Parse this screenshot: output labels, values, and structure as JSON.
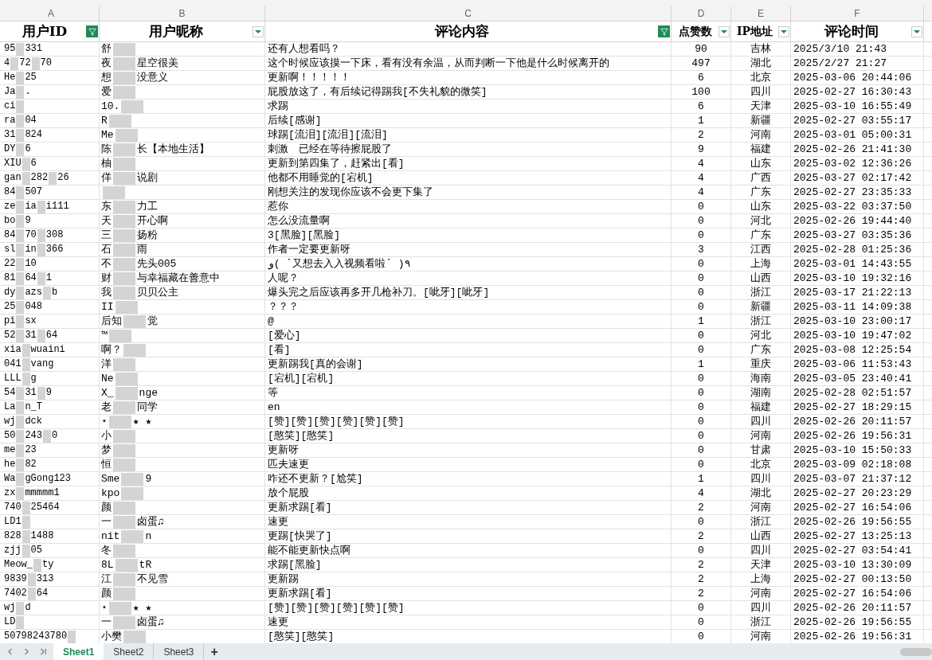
{
  "column_letters": [
    "A",
    "B",
    "C",
    "D",
    "E",
    "F"
  ],
  "header_row": [
    {
      "label": "用户ID",
      "filtered": true
    },
    {
      "label": "用户昵称",
      "filtered": false
    },
    {
      "label": "评论内容",
      "filtered": true
    },
    {
      "label": "点赞数",
      "filtered": false
    },
    {
      "label": "IP地址",
      "filtered": false
    },
    {
      "label": "评论时间",
      "filtered": false
    }
  ],
  "rows": [
    {
      "user_id": [
        "95",
        "331"
      ],
      "nickname": [
        "舒"
      ],
      "comment": "还有人想看吗？",
      "likes": "90",
      "ip": "吉林",
      "time": "2025/3/10 21:43"
    },
    {
      "user_id": [
        "4",
        "72",
        "70"
      ],
      "nickname": [
        "夜",
        "星空很美"
      ],
      "comment": "这个时候应该摸一下床，看有没有余温，从而判断一下他是什么时候离开的",
      "likes": "497",
      "ip": "湖北",
      "time": "2025/2/27 21:27"
    },
    {
      "user_id": [
        "He",
        "25"
      ],
      "nickname": [
        "想",
        "没意义"
      ],
      "comment": "更新啊！！！！！",
      "likes": "6",
      "ip": "北京",
      "time": "2025-03-06 20:44:06"
    },
    {
      "user_id": [
        "Ja",
        "."
      ],
      "nickname": [
        "爱"
      ],
      "comment": "屁股放这了，有后续记得踢我[不失礼貌的微笑]",
      "likes": "100",
      "ip": "四川",
      "time": "2025-02-27 16:30:43"
    },
    {
      "user_id": [
        "ci"
      ],
      "nickname": [
        "10."
      ],
      "comment": "求踢",
      "likes": "6",
      "ip": "天津",
      "time": "2025-03-10 16:55:49"
    },
    {
      "user_id": [
        "ra",
        "04"
      ],
      "nickname": [
        "R"
      ],
      "comment": "后续[感谢]",
      "likes": "1",
      "ip": "新疆",
      "time": "2025-02-27 03:55:17"
    },
    {
      "user_id": [
        "31",
        "824"
      ],
      "nickname": [
        "Me"
      ],
      "comment": "球踢[流泪][流泪][流泪]",
      "likes": "2",
      "ip": "河南",
      "time": "2025-03-01 05:00:31"
    },
    {
      "user_id": [
        "DY",
        "6"
      ],
      "nickname": [
        "陈",
        "长【本地生活】"
      ],
      "comment": "刺激　已经在等待擦屁股了",
      "likes": "9",
      "ip": "福建",
      "time": "2025-02-26 21:41:30"
    },
    {
      "user_id": [
        "XIU",
        "6"
      ],
      "nickname": [
        "柚"
      ],
      "comment": "更新到第四集了，赶紧出[看]",
      "likes": "4",
      "ip": "山东",
      "time": "2025-03-02 12:36:26"
    },
    {
      "user_id": [
        "gan",
        "282",
        "26"
      ],
      "nickname": [
        "佯",
        "说剧"
      ],
      "comment": "他都不用睡觉的[宕机]",
      "likes": "4",
      "ip": "广西",
      "time": "2025-03-27 02:17:42"
    },
    {
      "user_id": [
        "84",
        "507"
      ],
      "comment": "刚想关注的发现你应该不会更下集了",
      "likes": "4",
      "ip": "广东",
      "time": "2025-02-27 23:35:33"
    },
    {
      "user_id": [
        "ze",
        "ia",
        "i111"
      ],
      "nickname": [
        "东",
        "力工"
      ],
      "comment": "惹你",
      "likes": "0",
      "ip": "山东",
      "time": "2025-03-22 03:37:50"
    },
    {
      "user_id": [
        "bo",
        "9"
      ],
      "nickname": [
        "天",
        "开心啊"
      ],
      "comment": "怎么没流量啊",
      "likes": "0",
      "ip": "河北",
      "time": "2025-02-26 19:44:40"
    },
    {
      "user_id": [
        "84",
        "70",
        "308"
      ],
      "nickname": [
        "三",
        "扬粉"
      ],
      "comment": "3[黑脸][黑脸]",
      "likes": "0",
      "ip": "广东",
      "time": "2025-03-27 03:35:36"
    },
    {
      "user_id": [
        "sl",
        "in",
        "366"
      ],
      "nickname": [
        "石",
        "雨"
      ],
      "comment": "作者一定要更新呀",
      "likes": "3",
      "ip": "江西",
      "time": "2025-02-28 01:25:36"
    },
    {
      "user_id": [
        "22",
        "10"
      ],
      "nickname": [
        "不",
        "先头005"
      ],
      "comment": "و( ˋ又想去入入视频看啦ˊ )٩",
      "likes": "0",
      "ip": "上海",
      "time": "2025-03-01 14:43:55"
    },
    {
      "user_id": [
        "81",
        "64",
        "1"
      ],
      "nickname": [
        "财",
        "与幸福藏在善意中"
      ],
      "comment": "人呢？",
      "likes": "0",
      "ip": "山西",
      "time": "2025-03-10 19:32:16"
    },
    {
      "user_id": [
        "dy",
        "azs",
        "b"
      ],
      "nickname": [
        "我",
        "贝贝公主"
      ],
      "comment": "爆头完之后应该再多开几枪补刀。[呲牙][呲牙]",
      "likes": "0",
      "ip": "浙江",
      "time": "2025-03-17 21:22:13"
    },
    {
      "user_id": [
        "25",
        "048"
      ],
      "nickname": [
        "II"
      ],
      "comment": "？？？",
      "likes": "0",
      "ip": "新疆",
      "time": "2025-03-11 14:09:38"
    },
    {
      "user_id": [
        "pi",
        "sx"
      ],
      "nickname": [
        "后知",
        "觉"
      ],
      "comment": "@",
      "likes": "1",
      "ip": "浙江",
      "time": "2025-03-10 23:00:17"
    },
    {
      "user_id": [
        "52",
        "31",
        "64"
      ],
      "nickname": [
        "™"
      ],
      "comment": "[爱心]",
      "likes": "0",
      "ip": "河北",
      "time": "2025-03-10 19:47:02"
    },
    {
      "user_id": [
        "xia",
        "wuaini"
      ],
      "nickname": [
        "啊？"
      ],
      "comment": "[看]",
      "likes": "0",
      "ip": "广东",
      "time": "2025-03-08 12:25:54"
    },
    {
      "user_id": [
        "041",
        "vang"
      ],
      "nickname": [
        "洋"
      ],
      "comment": "更新踢我[真的会谢]",
      "likes": "1",
      "ip": "重庆",
      "time": "2025-03-06 11:53:43"
    },
    {
      "user_id": [
        "LLL",
        "g"
      ],
      "nickname": [
        "Ne"
      ],
      "comment": "[宕机][宕机]",
      "likes": "0",
      "ip": "海南",
      "time": "2025-03-05 23:40:41"
    },
    {
      "user_id": [
        "54",
        "31",
        "9"
      ],
      "nickname": [
        "X_",
        "nge"
      ],
      "comment": "等",
      "likes": "0",
      "ip": "湖南",
      "time": "2025-02-28 02:51:57"
    },
    {
      "user_id": [
        "La",
        "n_T"
      ],
      "nickname": [
        "老",
        "同学"
      ],
      "comment": "en",
      "likes": "0",
      "ip": "福建",
      "time": "2025-02-27 18:29:15"
    },
    {
      "user_id": [
        "wj",
        "dck"
      ],
      "nickname": [
        "⋆",
        "★ ★"
      ],
      "comment": "[赞][赞][赞][赞][赞][赞]",
      "likes": "0",
      "ip": "四川",
      "time": "2025-02-26 20:11:57"
    },
    {
      "user_id": [
        "50",
        "243",
        "0"
      ],
      "nickname": [
        "小"
      ],
      "comment": "[憨笑][憨笑]",
      "likes": "0",
      "ip": "河南",
      "time": "2025-02-26 19:56:31"
    },
    {
      "user_id": [
        "me",
        "23"
      ],
      "nickname": [
        "梦"
      ],
      "comment": "更新呀",
      "likes": "0",
      "ip": "甘肃",
      "time": "2025-03-10 15:50:33"
    },
    {
      "user_id": [
        "he",
        "82"
      ],
      "nickname": [
        "恒"
      ],
      "comment": "匹夫速更",
      "likes": "0",
      "ip": "北京",
      "time": "2025-03-09 02:18:08"
    },
    {
      "user_id": [
        "Wa",
        "gGong123"
      ],
      "nickname": [
        "Sme",
        "9"
      ],
      "comment": "咋还不更新？[尬笑]",
      "likes": "1",
      "ip": "四川",
      "time": "2025-03-07 21:37:12"
    },
    {
      "user_id": [
        "zx",
        "mmmmm1"
      ],
      "nickname": [
        "kpo"
      ],
      "comment": "放个屁股",
      "likes": "4",
      "ip": "湖北",
      "time": "2025-02-27 20:23:29"
    },
    {
      "user_id": [
        "740",
        "25464"
      ],
      "nickname": [
        "颜"
      ],
      "comment": "更新求踢[看]",
      "likes": "2",
      "ip": "河南",
      "time": "2025-02-27 16:54:06"
    },
    {
      "user_id": [
        "LD1"
      ],
      "nickname": [
        "一",
        "卤蛋♫"
      ],
      "comment": "速更",
      "likes": "0",
      "ip": "浙江",
      "time": "2025-02-26 19:56:55"
    },
    {
      "user_id": [
        "828",
        "1488"
      ],
      "nickname": [
        "nit",
        "n"
      ],
      "comment": "更踢[快哭了]",
      "likes": "2",
      "ip": "山西",
      "time": "2025-02-27 13:25:13"
    },
    {
      "user_id": [
        "zjj",
        "05"
      ],
      "nickname": [
        "冬"
      ],
      "comment": "能不能更新快点啊",
      "likes": "0",
      "ip": "四川",
      "time": "2025-02-27 03:54:41"
    },
    {
      "user_id": [
        "Meow_",
        "ty"
      ],
      "nickname": [
        "8L",
        "tR"
      ],
      "comment": "求踢[黑脸]",
      "likes": "2",
      "ip": "天津",
      "time": "2025-03-10 13:30:09"
    },
    {
      "user_id": [
        "9839",
        "313"
      ],
      "nickname": [
        "江",
        "不见雪"
      ],
      "comment": "更新踢",
      "likes": "2",
      "ip": "上海",
      "time": "2025-02-27 00:13:50"
    },
    {
      "user_id": [
        "7402",
        "64"
      ],
      "nickname": [
        "颜"
      ],
      "comment": "更新求踢[看]",
      "likes": "2",
      "ip": "河南",
      "time": "2025-02-27 16:54:06"
    },
    {
      "user_id": [
        "wj",
        "d"
      ],
      "nickname": [
        "⋆",
        "★ ★"
      ],
      "comment": "[赞][赞][赞][赞][赞][赞]",
      "likes": "0",
      "ip": "四川",
      "time": "2025-02-26 20:11:57"
    },
    {
      "user_id": [
        "LD"
      ],
      "nickname": [
        "一",
        "卤蛋♫"
      ],
      "comment": "速更",
      "likes": "0",
      "ip": "浙江",
      "time": "2025-02-26 19:56:55"
    },
    {
      "user_id": [
        "50798243780"
      ],
      "nickname": [
        "小樊"
      ],
      "comment": "[憨笑][憨笑]",
      "likes": "0",
      "ip": "河南",
      "time": "2025-02-26 19:56:31"
    }
  ],
  "sheet_tabs": [
    {
      "label": "Sheet1",
      "selected": true
    },
    {
      "label": "Sheet2",
      "selected": false
    },
    {
      "label": "Sheet3",
      "selected": false
    }
  ],
  "add_sheet": "+"
}
